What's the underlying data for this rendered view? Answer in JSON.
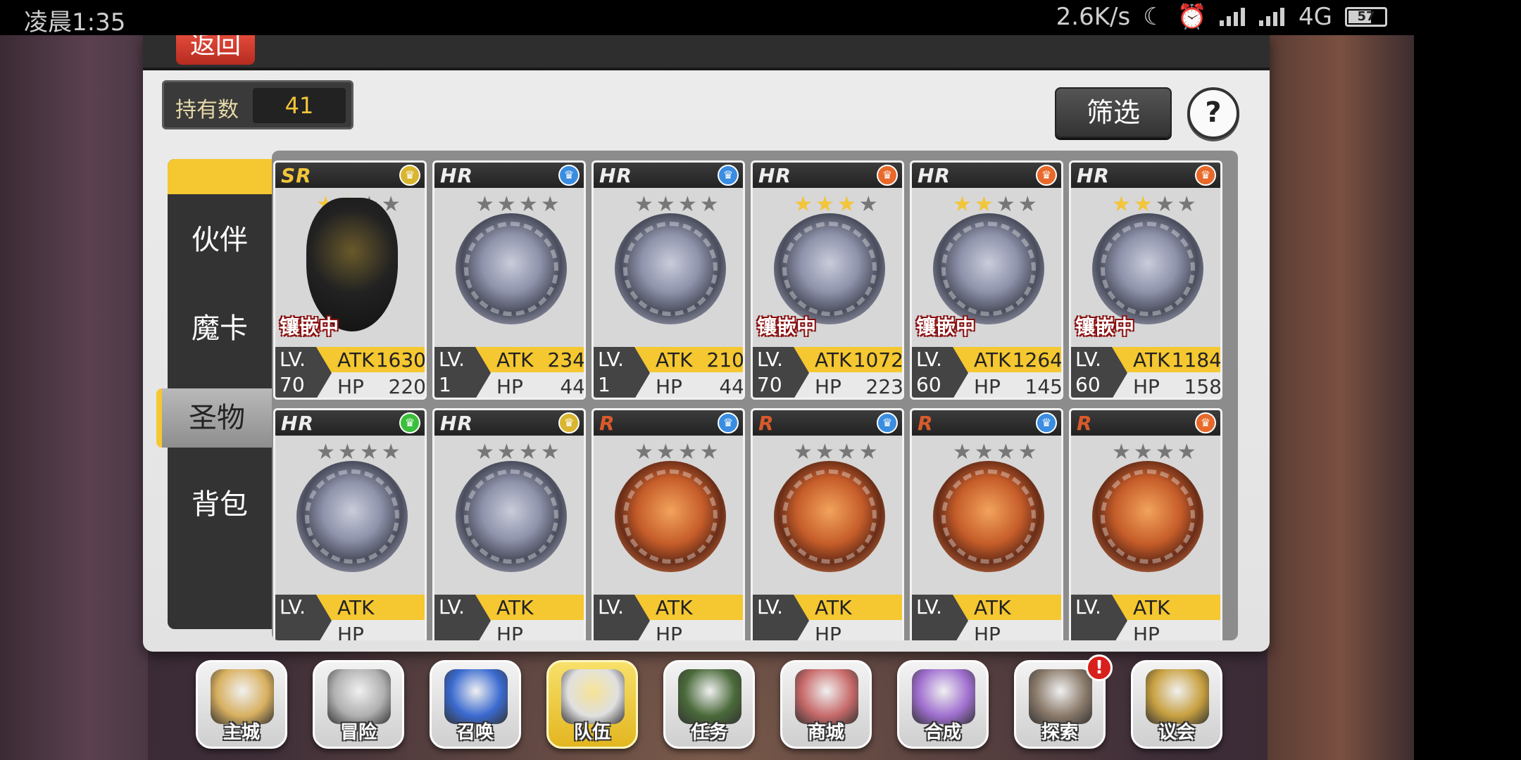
{
  "status_bar": {
    "time": "凌晨1:35",
    "speed": "2.6K/s",
    "network": "4G",
    "battery": "57"
  },
  "header": {
    "back_label": "返回"
  },
  "owned": {
    "label": "持有数",
    "value": "41"
  },
  "filter_label": "筛选",
  "help_label": "?",
  "tabs": [
    "伙伴",
    "魔卡",
    "圣物",
    "背包"
  ],
  "active_tab": "圣物",
  "embed_label": "镶嵌中",
  "lv_label": "LV.",
  "atk_label": "ATK",
  "hp_label": "HP",
  "cards": [
    {
      "rarity": "SR",
      "element": "yellow",
      "stars": 2,
      "embedded": true,
      "level": "70",
      "atk": "1630",
      "hp": "220",
      "medal": "dark"
    },
    {
      "rarity": "HR",
      "element": "blue",
      "stars": 0,
      "embedded": false,
      "level": "1",
      "atk": "234",
      "hp": "44",
      "medal": "silver"
    },
    {
      "rarity": "HR",
      "element": "blue",
      "stars": 0,
      "embedded": false,
      "level": "1",
      "atk": "210",
      "hp": "44",
      "medal": "silver"
    },
    {
      "rarity": "HR",
      "element": "orange",
      "stars": 3,
      "embedded": true,
      "level": "70",
      "atk": "1072",
      "hp": "223",
      "medal": "silver"
    },
    {
      "rarity": "HR",
      "element": "orange",
      "stars": 2,
      "embedded": true,
      "level": "60",
      "atk": "1264",
      "hp": "145",
      "medal": "silver"
    },
    {
      "rarity": "HR",
      "element": "orange",
      "stars": 2,
      "embedded": true,
      "level": "60",
      "atk": "1184",
      "hp": "158",
      "medal": "silver"
    },
    {
      "rarity": "HR",
      "element": "green",
      "stars": 0,
      "embedded": false,
      "level": "",
      "atk": "",
      "hp": "",
      "medal": "silver"
    },
    {
      "rarity": "HR",
      "element": "yellow",
      "stars": 0,
      "embedded": false,
      "level": "",
      "atk": "",
      "hp": "",
      "medal": "silver"
    },
    {
      "rarity": "R",
      "element": "blue",
      "stars": 0,
      "embedded": false,
      "level": "",
      "atk": "",
      "hp": "",
      "medal": "bronze"
    },
    {
      "rarity": "R",
      "element": "blue",
      "stars": 0,
      "embedded": false,
      "level": "",
      "atk": "",
      "hp": "",
      "medal": "bronze"
    },
    {
      "rarity": "R",
      "element": "blue",
      "stars": 0,
      "embedded": false,
      "level": "",
      "atk": "",
      "hp": "",
      "medal": "bronze"
    },
    {
      "rarity": "R",
      "element": "orange",
      "stars": 0,
      "embedded": false,
      "level": "",
      "atk": "",
      "hp": "",
      "medal": "bronze"
    }
  ],
  "element_colors": {
    "yellow": "#d9b530",
    "blue": "#3a8de0",
    "orange": "#e8692a",
    "green": "#3cbf3c"
  },
  "nav": [
    {
      "label": "主城",
      "icon": "crown-icon",
      "color": "#d8b060"
    },
    {
      "label": "冒险",
      "icon": "crossed-swords-icon",
      "color": "#b0b0b0"
    },
    {
      "label": "召唤",
      "icon": "summon-card-icon",
      "color": "#3a6ad0"
    },
    {
      "label": "队伍",
      "icon": "winged-shield-icon",
      "color": "#e0e0e0",
      "active": true
    },
    {
      "label": "任务",
      "icon": "quest-book-icon",
      "color": "#4a6a3a"
    },
    {
      "label": "商城",
      "icon": "mushroom-shop-icon",
      "color": "#c86a6a"
    },
    {
      "label": "合成",
      "icon": "potion-flask-icon",
      "color": "#a070d0"
    },
    {
      "label": "探索",
      "icon": "shovel-compass-icon",
      "color": "#8a7a6a",
      "badge": "!"
    },
    {
      "label": "议会",
      "icon": "council-crest-icon",
      "color": "#c8a040"
    }
  ]
}
